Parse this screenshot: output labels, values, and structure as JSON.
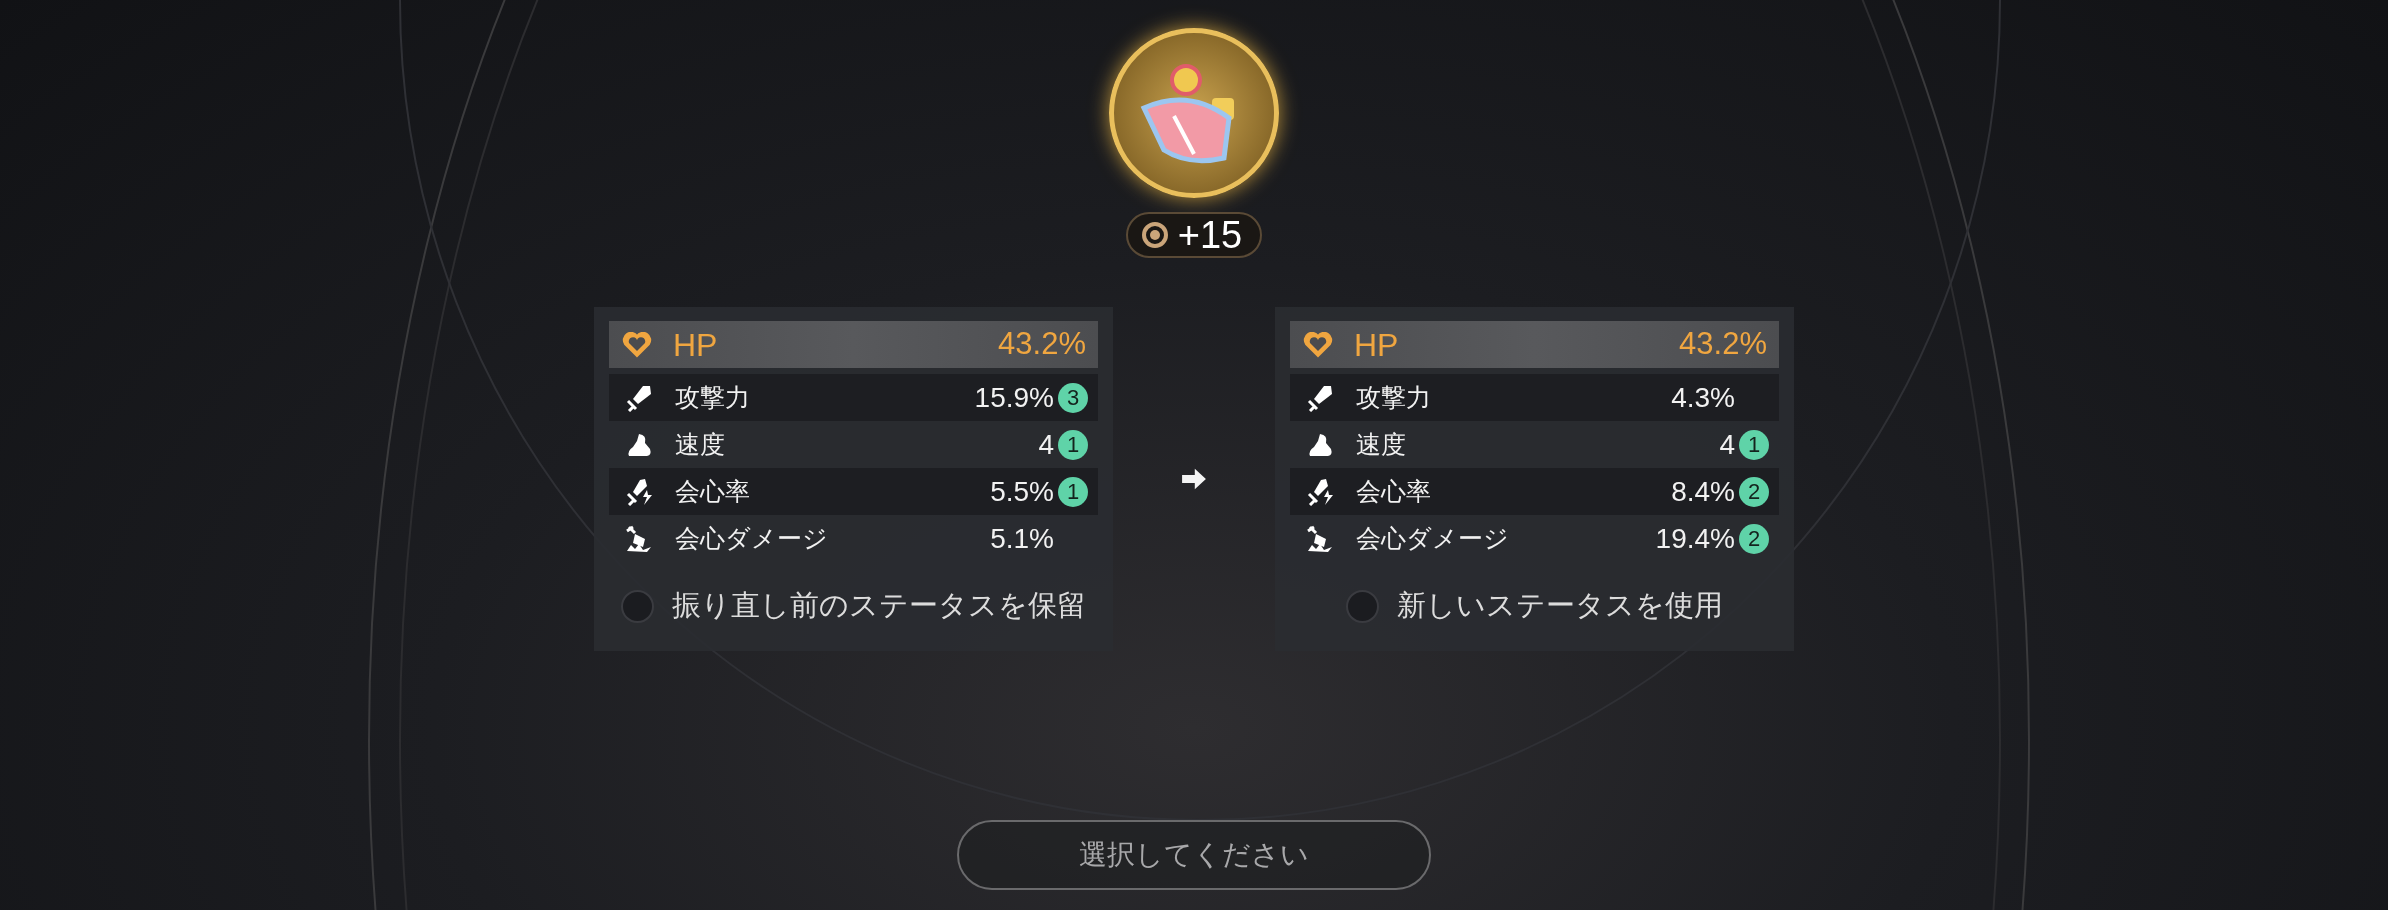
{
  "item": {
    "level": "+15"
  },
  "panels": [
    {
      "stats": [
        {
          "kind": "hp",
          "label": "HP",
          "value": "43.2%"
        },
        {
          "kind": "attack",
          "label": "攻撃力",
          "value": "15.9%",
          "badge": "3"
        },
        {
          "kind": "speed",
          "label": "速度",
          "value": "4",
          "badge": "1"
        },
        {
          "kind": "crit",
          "label": "会心率",
          "value": "5.5%",
          "badge": "1"
        },
        {
          "kind": "critdmg",
          "label": "会心ダメージ",
          "value": "5.1%"
        }
      ],
      "option": {
        "label": "振り直し前のステータスを保留",
        "selected": false
      }
    },
    {
      "stats": [
        {
          "kind": "hp",
          "label": "HP",
          "value": "43.2%"
        },
        {
          "kind": "attack",
          "label": "攻撃力",
          "value": "4.3%"
        },
        {
          "kind": "speed",
          "label": "速度",
          "value": "4",
          "badge": "1"
        },
        {
          "kind": "crit",
          "label": "会心率",
          "value": "8.4%",
          "badge": "2"
        },
        {
          "kind": "critdmg",
          "label": "会心ダメージ",
          "value": "19.4%",
          "badge": "2"
        }
      ],
      "option": {
        "label": "新しいステータスを使用",
        "selected": false
      }
    }
  ],
  "confirm_button": "選択してください"
}
